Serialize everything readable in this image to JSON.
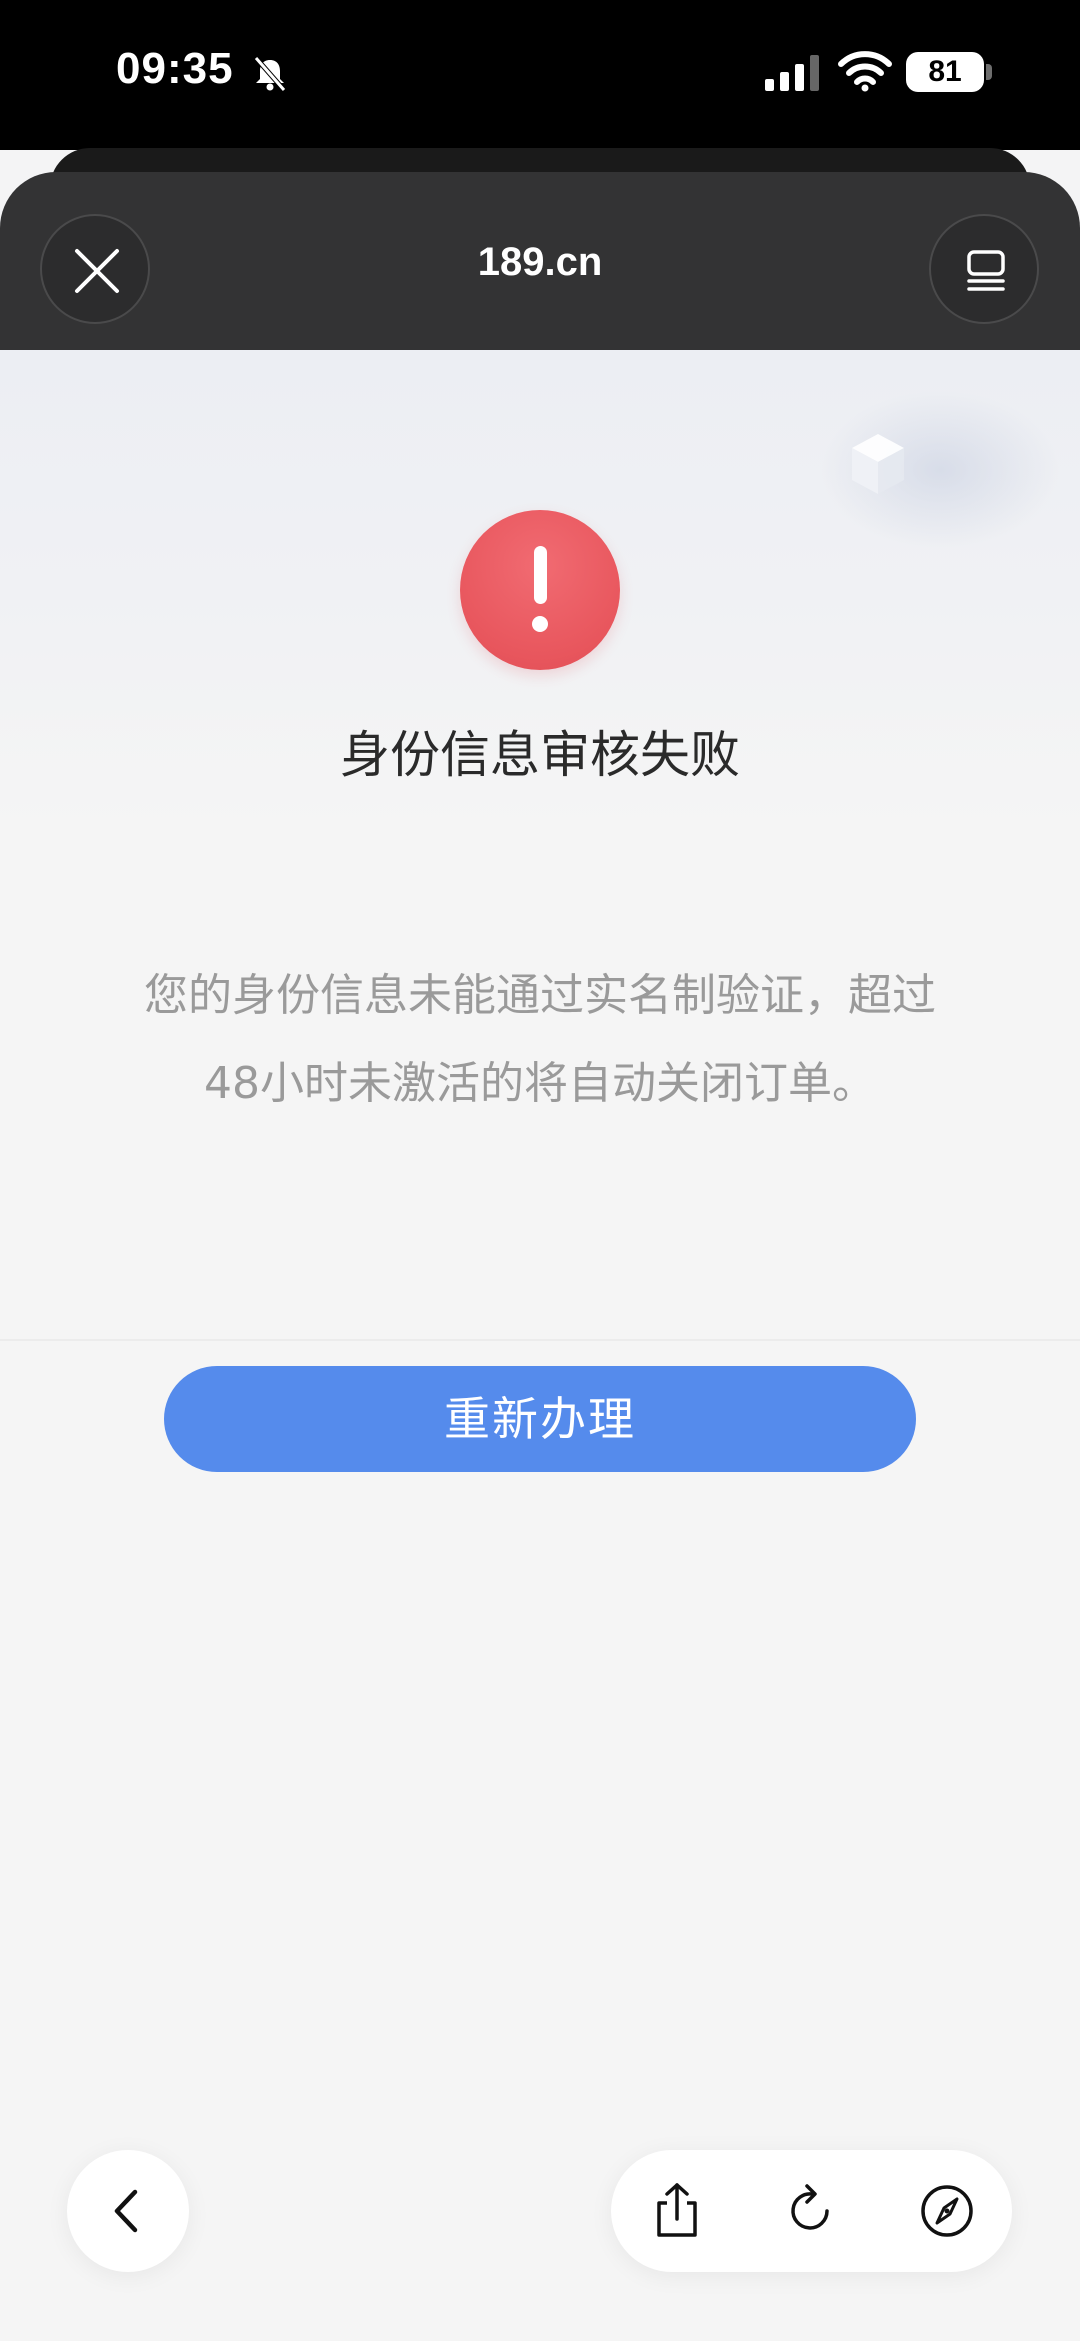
{
  "status_bar": {
    "time": "09:35",
    "battery": "81"
  },
  "browser": {
    "domain": "189.cn"
  },
  "page": {
    "title": "身份信息审核失败",
    "message_line1": "您的身份信息未能通过实名制验证，超过",
    "message_line2": "48小时未激活的将自动关闭订单。",
    "button_label": "重新办理"
  },
  "colors": {
    "alert": "#e8565d",
    "primary": "#558bec"
  },
  "icons": [
    "mute-icon",
    "signal-icon",
    "wifi-icon",
    "close-icon",
    "tab-overview-icon",
    "alert-icon",
    "back-icon",
    "share-icon",
    "reload-icon",
    "compass-icon"
  ]
}
